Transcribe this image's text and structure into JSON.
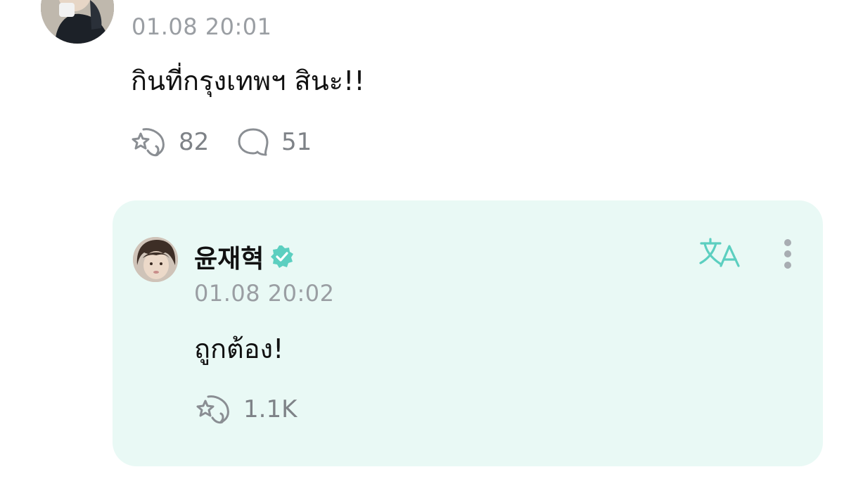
{
  "post": {
    "timestamp": "01.08 20:01",
    "text": "กินที่กรุงเทพฯ สินะ!!",
    "like_count": "82",
    "comment_count": "51"
  },
  "reply": {
    "author": "윤재혁",
    "timestamp": "01.08 20:02",
    "text": "ถูกต้อง!",
    "like_count": "1.1K"
  },
  "colors": {
    "accent": "#5ccfc0",
    "reply_bg": "#e9f9f5",
    "muted": "#9a9ea3"
  },
  "icons": {
    "translate": "translate-icon",
    "more": "more-vertical-icon",
    "like": "like-star-icon",
    "comment": "comment-bubble-icon",
    "verified": "verified-badge-icon"
  }
}
